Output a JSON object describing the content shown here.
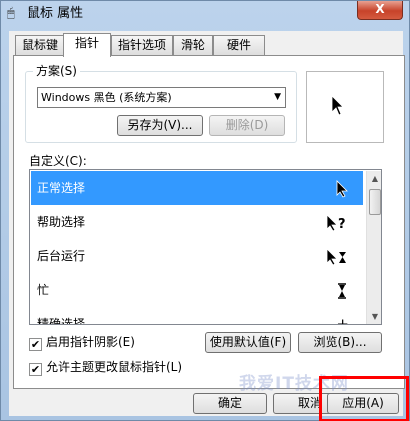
{
  "window": {
    "title": "鼠标 属性",
    "close_label": "X",
    "title_icon": "mouse-icon"
  },
  "tabs": [
    {
      "label": "鼠标键",
      "active": false
    },
    {
      "label": "指针",
      "active": true
    },
    {
      "label": "指针选项",
      "active": false
    },
    {
      "label": "滑轮",
      "active": false
    },
    {
      "label": "硬件",
      "active": false
    }
  ],
  "scheme": {
    "label": "方案(S)",
    "selected": "Windows 黑色 (系统方案)",
    "save_as": "另存为(V)...",
    "delete": "删除(D)"
  },
  "customize": {
    "label": "自定义(C):",
    "items": [
      {
        "label": "正常选择",
        "selected": true,
        "icon": "arrow-cursor-icon"
      },
      {
        "label": "帮助选择",
        "selected": false,
        "icon": "help-cursor-icon"
      },
      {
        "label": "后台运行",
        "selected": false,
        "icon": "working-cursor-icon"
      },
      {
        "label": "忙",
        "selected": false,
        "icon": "busy-cursor-icon"
      },
      {
        "label": "精确选择",
        "selected": false,
        "icon": "precision-cursor-icon"
      }
    ]
  },
  "options": {
    "shadow": {
      "label": "启用指针阴影(E)",
      "checked": true
    },
    "theme": {
      "label": "允许主题更改鼠标指针(L)",
      "checked": true
    },
    "use_default": "使用默认值(F)",
    "browse": "浏览(B)..."
  },
  "footer": {
    "ok": "确定",
    "cancel": "取消",
    "apply": "应用(A)"
  },
  "watermark": "我爱IT技术网",
  "colors": {
    "selection": "#3399ff",
    "highlight": "#ff0000"
  }
}
